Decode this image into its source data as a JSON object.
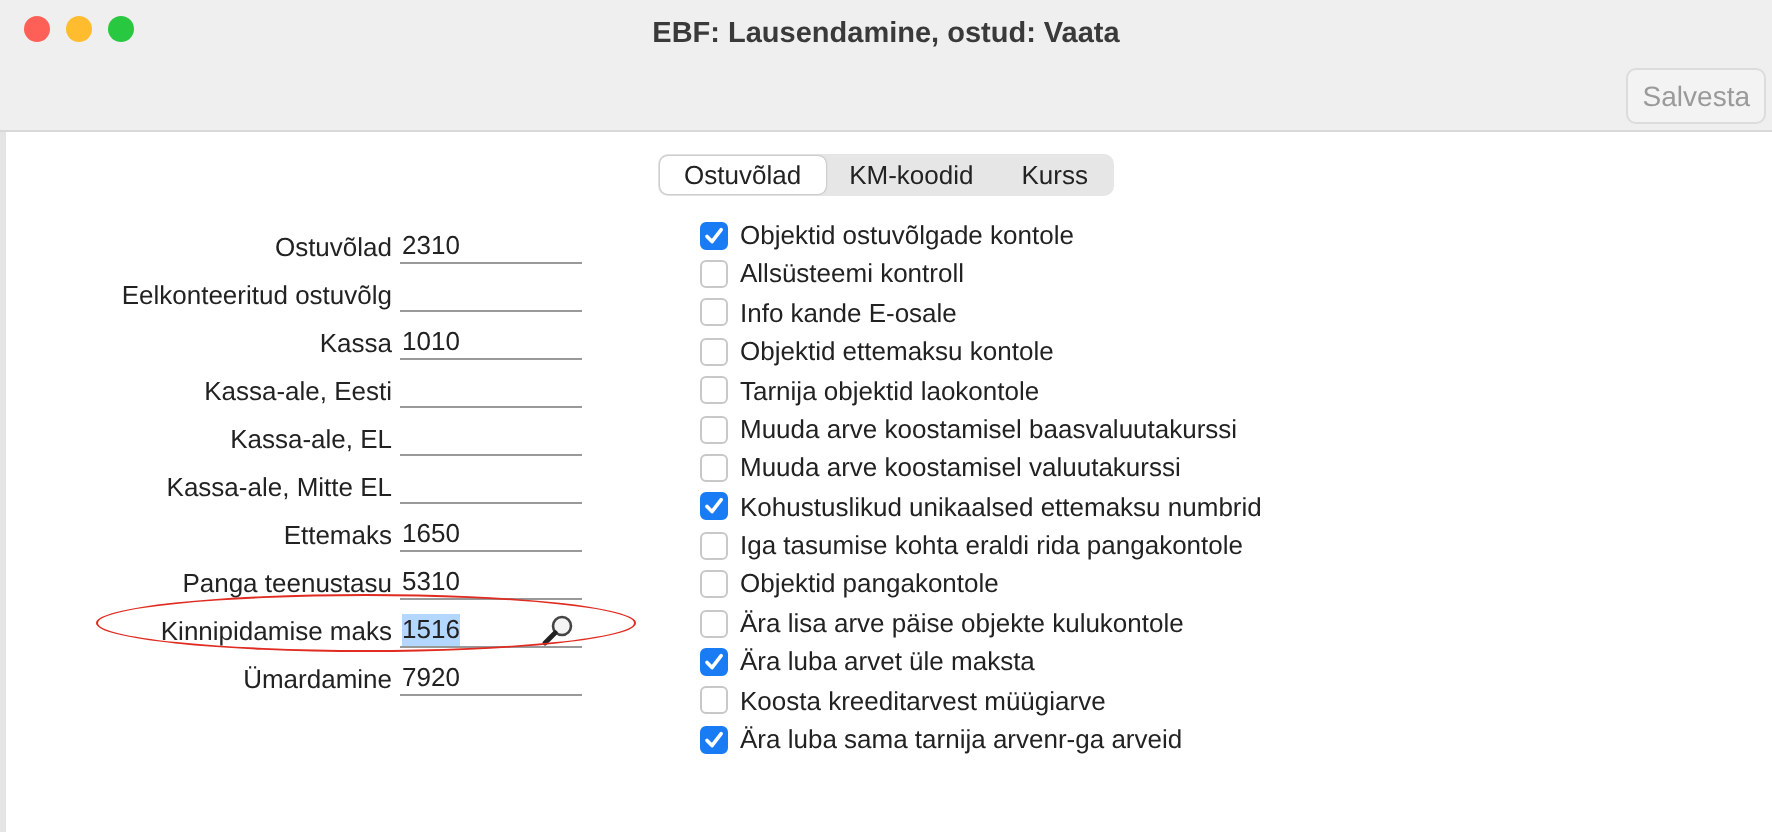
{
  "window": {
    "title": "EBF: Lausendamine, ostud: Vaata"
  },
  "toolbar": {
    "buttons": [
      {
        "label": "Salvesta",
        "disabled": true
      }
    ]
  },
  "tabs": [
    {
      "label": "Ostuvõlad",
      "selected": true
    },
    {
      "label": "KM-koodid",
      "selected": false
    },
    {
      "label": "Kurss",
      "selected": false
    }
  ],
  "fields": [
    {
      "label": "Ostuvõlad",
      "value": "2310",
      "value_selected": false,
      "lookup": false,
      "circled": false
    },
    {
      "label": "Eelkonteeritud ostuvõlg",
      "lookup": false,
      "circled": false
    },
    {
      "label": "Kassa",
      "value": "1010",
      "value_selected": false,
      "lookup": false,
      "circled": false
    },
    {
      "label": "Kassa-ale, Eesti",
      "lookup": false,
      "circled": false
    },
    {
      "label": "Kassa-ale, EL",
      "lookup": false,
      "circled": false
    },
    {
      "label": "Kassa-ale, Mitte EL",
      "lookup": false,
      "circled": false
    },
    {
      "label": "Ettemaks",
      "value": "1650",
      "value_selected": false,
      "lookup": false,
      "circled": false
    },
    {
      "label": "Panga teenustasu",
      "value": "5310",
      "value_selected": false,
      "lookup": false,
      "circled": false
    },
    {
      "label": "Kinnipidamise maks",
      "value": "1516",
      "value_selected": true,
      "lookup": true,
      "circled": true
    },
    {
      "label": "Ümardamine",
      "value": "7920",
      "value_selected": false,
      "lookup": false,
      "circled": false
    }
  ],
  "options": [
    {
      "label": "Objektid ostuvõlgade kontole",
      "checked": true
    },
    {
      "label": "Allsüsteemi kontroll",
      "checked": false
    },
    {
      "label": "Info kande E-osale",
      "checked": false
    },
    {
      "label": "Objektid ettemaksu kontole",
      "checked": false
    },
    {
      "label": "Tarnija objektid laokontole",
      "checked": false
    },
    {
      "label": "Muuda arve koostamisel baasvaluutakurssi",
      "checked": false
    },
    {
      "label": "Muuda arve koostamisel valuutakurssi",
      "checked": false
    },
    {
      "label": "Kohustuslikud unikaalsed ettemaksu numbrid",
      "checked": true
    },
    {
      "label": "Iga tasumise kohta eraldi rida pangakontole",
      "checked": false
    },
    {
      "label": "Objektid pangakontole",
      "checked": false
    },
    {
      "label": "Ära lisa arve päise objekte kulukontole",
      "checked": false
    },
    {
      "label": "Ära luba arvet üle maksta",
      "checked": true
    },
    {
      "label": "Koosta kreeditarvest müügiarve",
      "checked": false
    },
    {
      "label": "Ära luba sama tarnija arvenr-ga arveid",
      "checked": true
    }
  ]
}
